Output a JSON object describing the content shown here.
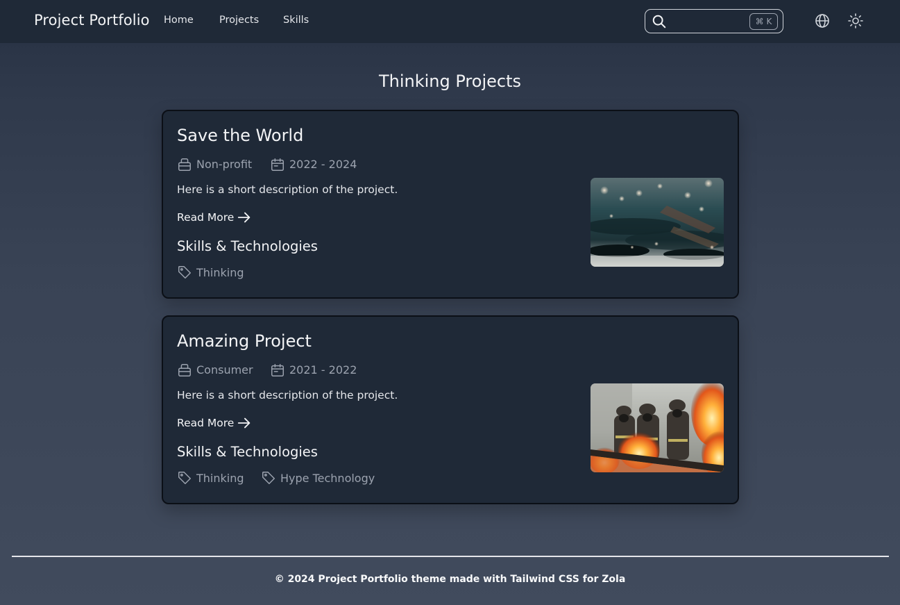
{
  "header": {
    "brand": "Project Portfolio",
    "nav": [
      "Home",
      "Projects",
      "Skills"
    ],
    "search": {
      "placeholder": "",
      "shortcut": "⌘ K"
    },
    "icons": [
      "search-icon",
      "globe-icon",
      "sun-icon"
    ]
  },
  "page": {
    "title": "Thinking Projects"
  },
  "projects": [
    {
      "title": "Save the World",
      "category": "Non-profit",
      "dates": "2022 - 2024",
      "description": "Here is a short description of the project.",
      "read_more": "Read More",
      "skills_heading": "Skills & Technologies",
      "tags": [
        "Thinking"
      ],
      "image": "dark-teal-water-bokeh-photo"
    },
    {
      "title": "Amazing Project",
      "category": "Consumer",
      "dates": "2021 - 2022",
      "description": "Here is a short description of the project.",
      "read_more": "Read More",
      "skills_heading": "Skills & Technologies",
      "tags": [
        "Thinking",
        "Hype Technology"
      ],
      "image": "firefighters-flames-photo"
    }
  ],
  "footer": {
    "text": "© 2024 Project Portfolio theme made with Tailwind CSS for Zola"
  },
  "colors": {
    "navbar": "#1f2937",
    "card": "#1f2937",
    "muted_text": "#9ca3af",
    "text": "#e5e7eb"
  }
}
